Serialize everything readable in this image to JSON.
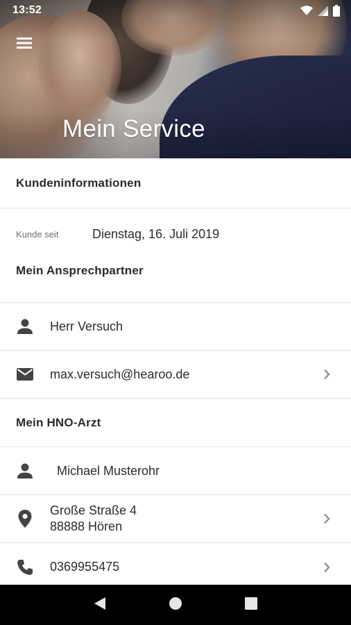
{
  "status_bar": {
    "time": "13:52"
  },
  "header": {
    "title": "Mein Service"
  },
  "customer_info": {
    "heading": "Kundeninformationen",
    "since_label": "Kunde seit",
    "since_value": "Dienstag, 16. Juli 2019"
  },
  "contact_person": {
    "heading": "Mein Ansprechpartner",
    "name": "Herr Versuch",
    "email": "max.versuch@hearoo.de"
  },
  "ent_doctor": {
    "heading": "Mein HNO-Arzt",
    "name": "Michael Musterohr",
    "address_line1": "Große Straße 4",
    "address_line2": "88888 Hören",
    "phone": "0369955475"
  },
  "icons": {
    "menu": "hamburger-icon",
    "person": "person-icon",
    "email": "envelope-icon",
    "location": "location-pin-icon",
    "phone": "phone-icon",
    "chevron": "chevron-right-icon"
  },
  "colors": {
    "icon": "#444444",
    "chevron": "#8a8a8a",
    "divider": "#e4e4e4",
    "nav_bar": "#000000"
  }
}
